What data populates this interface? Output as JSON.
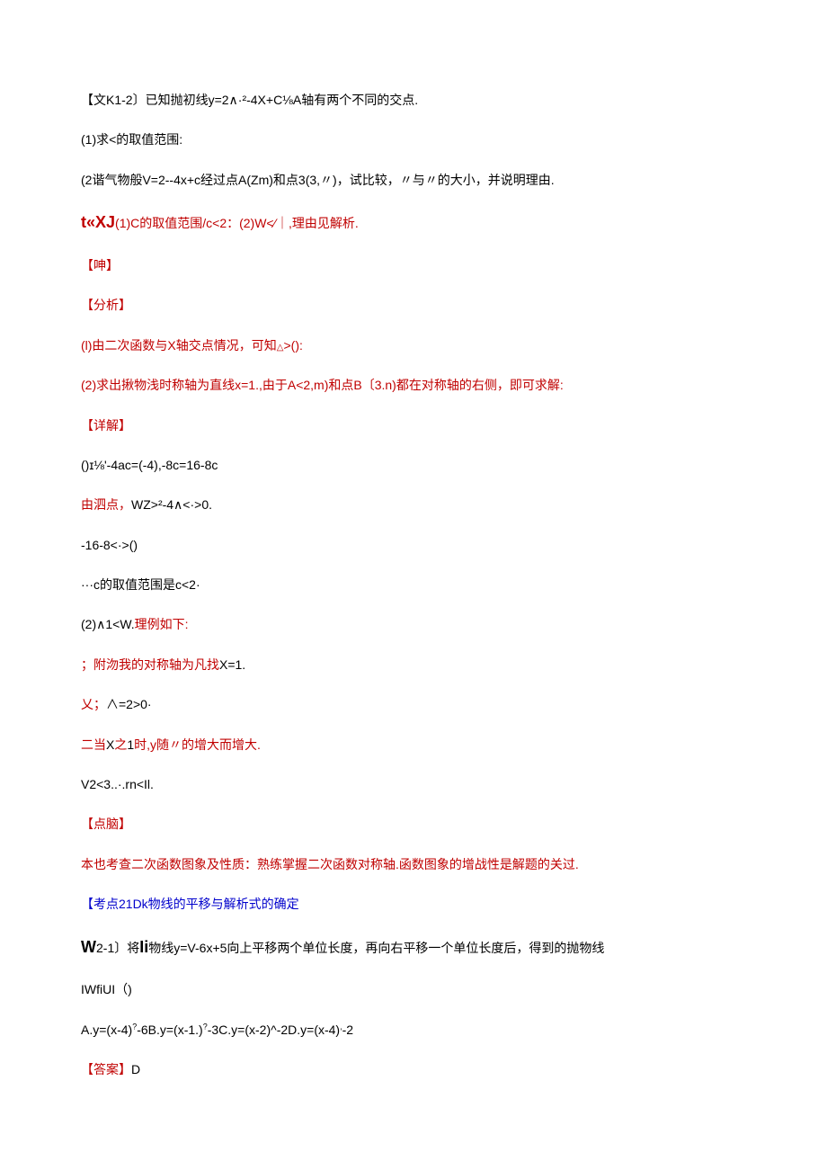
{
  "lines": [
    {
      "cls": "black",
      "text": "【文K1-2〕已知抛初线y=2∧·²-4X+C⅛A轴有两个不同的交点."
    },
    {
      "cls": "black",
      "text": "(1)求<的取值范围:"
    },
    {
      "cls": "black",
      "text": "(2谐气物般V=2--4x+c经过点A(Zm)和点3(3,〃)，试比较，〃与〃的大小，并说明理由."
    },
    {
      "cls": "mixed",
      "parts": [
        {
          "cls": "red bold big",
          "text": "t«XJ"
        },
        {
          "cls": "red",
          "text": "(1)C的取值范围/c<2：(2)W<∕｜,理由见解析."
        }
      ]
    },
    {
      "cls": "red",
      "text": "【呻】"
    },
    {
      "cls": "red",
      "text": "【分析】"
    },
    {
      "cls": "mixed",
      "parts": [
        {
          "cls": "red",
          "text": "(l)由二次函数与X轴交点情况，可知"
        },
        {
          "cls": "red triangle",
          "text": "△"
        },
        {
          "cls": "red",
          "text": ">():"
        }
      ]
    },
    {
      "cls": "red",
      "text": "(2)求出揪物浅时称轴为直线x=1.,由于A<2,m)和点B〔3.n)都在对称轴的右侧，即可求解:"
    },
    {
      "cls": "red",
      "text": "【详解】"
    },
    {
      "cls": "black",
      "text": "()ɪ⅛'-4ac=(-4),-8c=16-8c"
    },
    {
      "cls": "mixed",
      "parts": [
        {
          "cls": "red",
          "text": "由泗点，"
        },
        {
          "cls": "black",
          "text": "WZ>²-4∧<·>0."
        }
      ]
    },
    {
      "cls": "black",
      "text": "-16-8<·>()"
    },
    {
      "cls": "black",
      "text": "···c的取值范围是c<2·"
    },
    {
      "cls": "mixed",
      "parts": [
        {
          "cls": "black",
          "text": "(2)∧1<W."
        },
        {
          "cls": "red",
          "text": "理例如下:"
        }
      ]
    },
    {
      "cls": "mixed",
      "parts": [
        {
          "cls": "red",
          "text": "；附沕我的对称轴为凡找"
        },
        {
          "cls": "black",
          "text": "X=1."
        }
      ]
    },
    {
      "cls": "mixed",
      "parts": [
        {
          "cls": "red",
          "text": "乂；"
        },
        {
          "cls": "black",
          "text": "∧=2>0·"
        }
      ]
    },
    {
      "cls": "mixed",
      "parts": [
        {
          "cls": "red",
          "text": "二当"
        },
        {
          "cls": "black",
          "text": "X"
        },
        {
          "cls": "red",
          "text": "之"
        },
        {
          "cls": "black",
          "text": "1"
        },
        {
          "cls": "red",
          "text": "时,y随〃的增大而增大."
        }
      ]
    },
    {
      "cls": "black",
      "text": "V2<3..·.rn<Il."
    },
    {
      "cls": "red",
      "text": "【点脑】"
    },
    {
      "cls": "red",
      "text": "本也考查二次函数图象及性质：熟练掌握二次函数对称轴.函数图象的增战性是解题的关过."
    },
    {
      "cls": "blue",
      "text": "【考点21Dk物线的平移与解析式的确定"
    },
    {
      "cls": "mixed",
      "parts": [
        {
          "cls": "black bold big",
          "text": "W"
        },
        {
          "cls": "black",
          "text": "2-1〕将"
        },
        {
          "cls": "black bold big",
          "text": "Ii"
        },
        {
          "cls": "black",
          "text": "物线y=V-6x+5向上平移两个单位长度，再向右平移一个单位长度后，得到的抛物线"
        }
      ]
    },
    {
      "cls": "black",
      "text": "IWfiUI（)"
    },
    {
      "cls": "mixed",
      "parts": [
        {
          "cls": "black",
          "text": "A.y=(x-4)"
        },
        {
          "cls": "black sup",
          "text": "?"
        },
        {
          "cls": "black",
          "text": "-6B.y=(x-1.)"
        },
        {
          "cls": "black sup",
          "text": "?"
        },
        {
          "cls": "black",
          "text": "-3C.y=(x-2)^-2D.y=(x-4)"
        },
        {
          "cls": "black sup",
          "text": ","
        },
        {
          "cls": "black",
          "text": "-2"
        }
      ]
    },
    {
      "cls": "mixed",
      "parts": [
        {
          "cls": "red",
          "text": "【答案】"
        },
        {
          "cls": "black",
          "text": "D"
        }
      ]
    }
  ]
}
